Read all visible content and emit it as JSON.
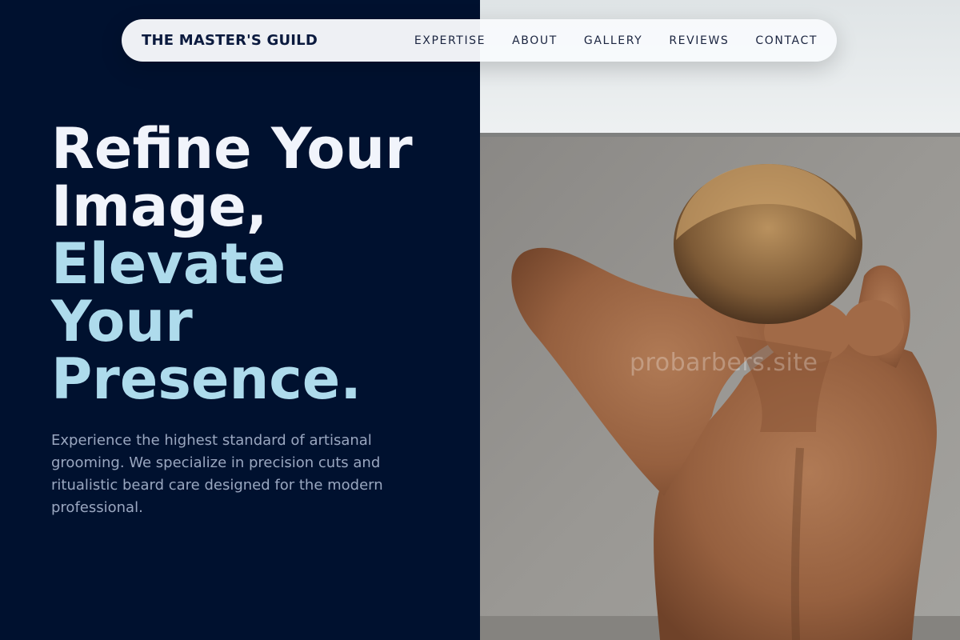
{
  "nav": {
    "brand": "THE MASTER'S GUILD",
    "links": [
      "EXPERTISE",
      "ABOUT",
      "GALLERY",
      "REVIEWS",
      "CONTACT"
    ]
  },
  "hero": {
    "title_lines": [
      "Refine Your",
      "Image,"
    ],
    "accent_lines": [
      "Elevate",
      "Your",
      "Presence."
    ],
    "description": "Experience the highest standard of artisanal grooming. We specialize in precision cuts and ritualistic beard care designed for the modern professional."
  },
  "image": {
    "watermark": "probarbers.site"
  },
  "colors": {
    "background": "#00112f",
    "title": "#f1f4fb",
    "accent": "#aedbec",
    "body_text": "#9aa7c0",
    "navbar": "#f8fafc",
    "brand": "#0b1a3e"
  }
}
